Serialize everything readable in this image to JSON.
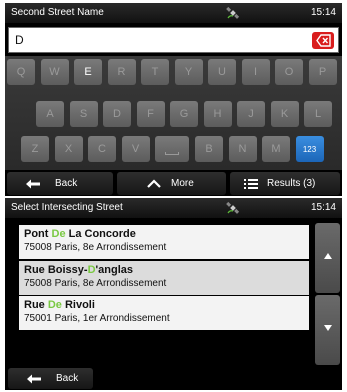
{
  "screen1": {
    "title": "Second Street Name",
    "time": "15:14",
    "search": {
      "value": "D"
    },
    "keyboard": {
      "row1": [
        "Q",
        "W",
        "E",
        "R",
        "T",
        "Y",
        "U",
        "I",
        "O",
        "P"
      ],
      "row2": [
        "A",
        "S",
        "D",
        "F",
        "G",
        "H",
        "J",
        "K",
        "L"
      ],
      "row3": [
        "Z",
        "X",
        "C",
        "V",
        "",
        "B",
        "N",
        "M",
        "123"
      ],
      "active_keys": [
        "E"
      ]
    },
    "bottombar": {
      "back_label": "Back",
      "more_label": "More",
      "results_label": "Results (3)"
    }
  },
  "screen2": {
    "title": "Select Intersecting Street",
    "time": "15:14",
    "items": [
      {
        "name_pre": "Pont ",
        "name_hl": "De",
        "name_post": " La Concorde",
        "address": "75008 Paris, 8e Arrondissement"
      },
      {
        "name_pre": "Rue Boissy-",
        "name_hl": "D",
        "name_post": "'anglas",
        "address": "75008 Paris, 8e Arrondissement"
      },
      {
        "name_pre": "Rue ",
        "name_hl": "De",
        "name_post": " Rivoli",
        "address": "75001 Paris, 1er Arrondissement"
      }
    ],
    "back_label": "Back"
  },
  "colors": {
    "highlight": "#7ac943",
    "delete_button": "#d91d1d",
    "numeric_key": "#1c66b8"
  },
  "icons": {
    "gps": "gps-satellite-icon",
    "delete": "backspace-icon",
    "back": "arrow-left-icon",
    "more": "chevron-up-icon",
    "results": "list-icon",
    "scroll_up": "triangle-up-icon",
    "scroll_down": "triangle-down-icon"
  }
}
